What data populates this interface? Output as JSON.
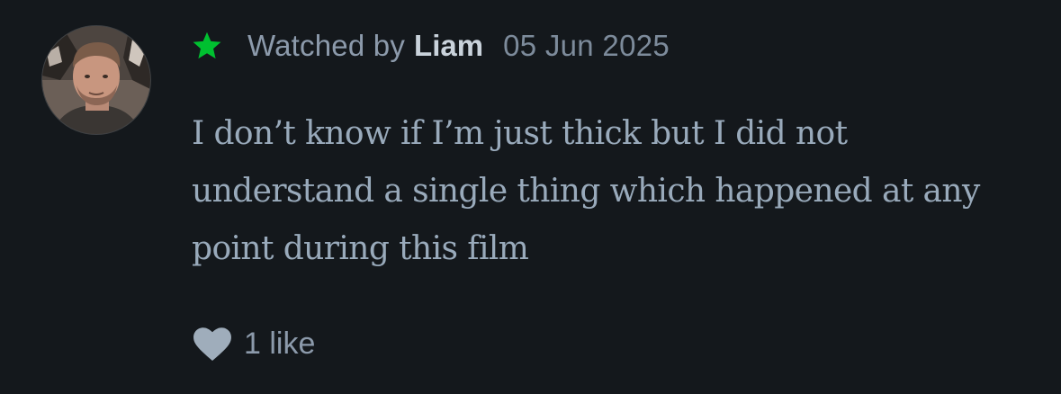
{
  "review": {
    "avatar_icon": "user-avatar-photo",
    "rating_icon": "star-icon",
    "accent_color": "#00c030",
    "watched_label": "Watched by",
    "username": "Liam",
    "date": "05 Jun 2025",
    "text": "I don’t know if I’m just thick but I did not understand a single thing which happened at any point during this film",
    "like_icon": "heart-icon",
    "like_count_label": "1 like"
  }
}
